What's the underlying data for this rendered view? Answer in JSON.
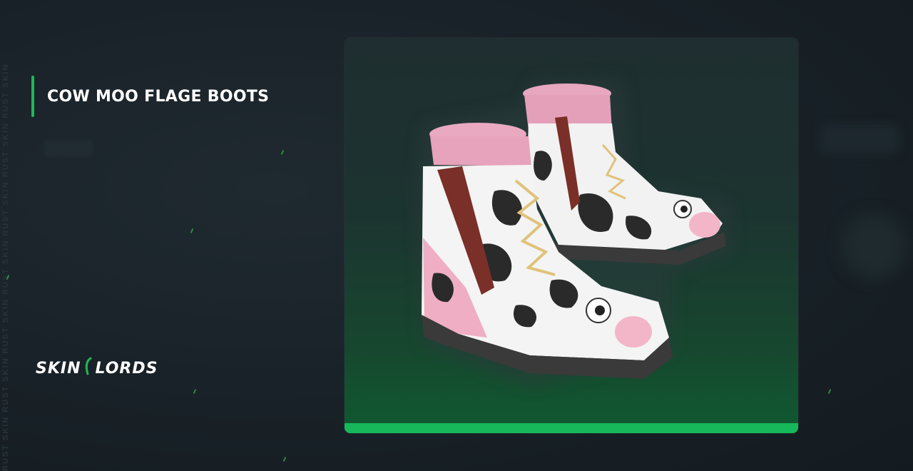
{
  "item": {
    "name": "COW MOO FLAGE BOOTS"
  },
  "brand": {
    "logo_text_left": "SKIN",
    "logo_text_right": "LORDS"
  },
  "watermark": {
    "side_text": "RUST SKIN RUST SKIN RUST SKIN RUST SKIN RUST SKIN RUST SKIN RUST SKIN"
  },
  "colors": {
    "accent": "#1db954",
    "card_bar": "#17b85a",
    "background": "#182127"
  },
  "image": {
    "subject": "cow-print-boots-icon"
  }
}
